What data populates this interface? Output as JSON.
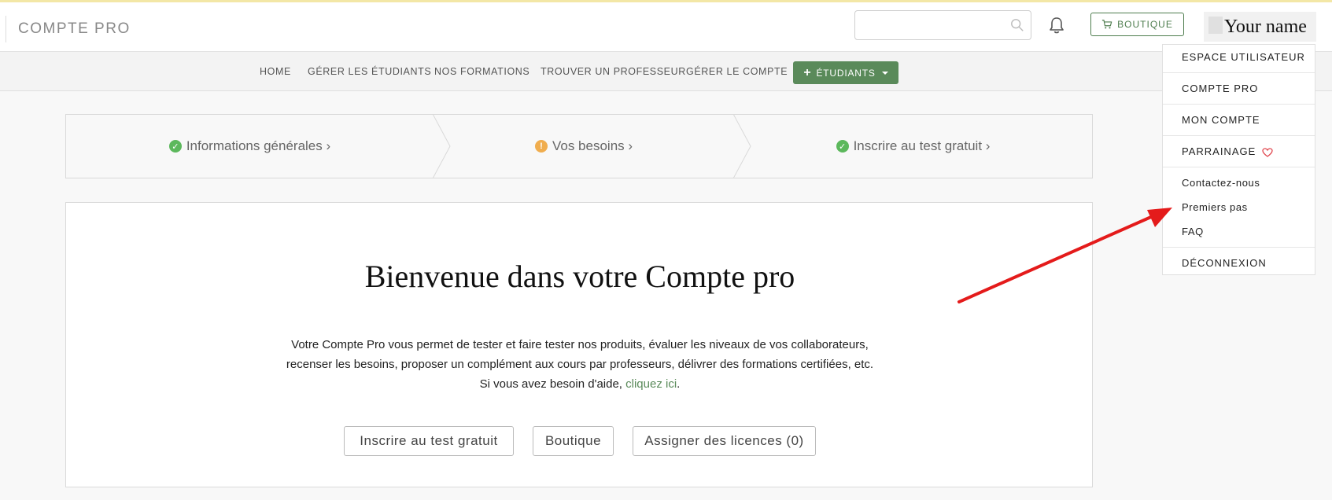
{
  "header": {
    "brand": "COMPTE PRO",
    "search": {
      "value": "",
      "placeholder": ""
    },
    "shop_label": "BOUTIQUE",
    "user_name": "Your name"
  },
  "nav": {
    "items": [
      "HOME",
      "GÉRER LES ÉTUDIANTS",
      "NOS FORMATIONS",
      "TROUVER UN PROFESSEUR",
      "GÉRER LE COMPTE"
    ],
    "etudiants_label": "ÉTUDIANTS"
  },
  "steps": [
    {
      "label": "Informations générales ›",
      "status": "done",
      "color": "#5cb85c"
    },
    {
      "label": "Vos besoins ›",
      "status": "warning",
      "color": "#f0ad4e"
    },
    {
      "label": "Inscrire au test gratuit ›",
      "status": "done",
      "color": "#5cb85c"
    }
  ],
  "main": {
    "title": "Bienvenue dans votre Compte pro",
    "line1": "Votre Compte Pro vous permet de tester et faire tester nos produits, évaluer les niveaux de vos collaborateurs,",
    "line2": "recenser les besoins, proposer un complément aux cours par professeurs, délivrer des formations certifiées, etc.",
    "line3_prefix": "Si vous avez besoin d'aide, ",
    "help_link": "cliquez ici",
    "line3_suffix": ".",
    "buttons": [
      "Inscrire au test gratuit",
      "Boutique",
      "Assigner des licences (0)"
    ]
  },
  "dropdown": {
    "items": [
      "ESPACE UTILISATEUR",
      "COMPTE PRO",
      "MON COMPTE",
      "PARRAINAGE",
      "Contactez-nous",
      "Premiers pas",
      "FAQ",
      "DÉCONNEXION"
    ]
  },
  "colors": {
    "accent_green": "#5a8a5a",
    "annotation_arrow": "#e41b1b",
    "heart": "#e0464d"
  },
  "icons": {
    "search": "search-icon",
    "bell": "bell-icon",
    "cart": "cart-icon",
    "heart": "heart-icon",
    "check": "check-circle-icon",
    "warning": "exclamation-circle-icon"
  }
}
